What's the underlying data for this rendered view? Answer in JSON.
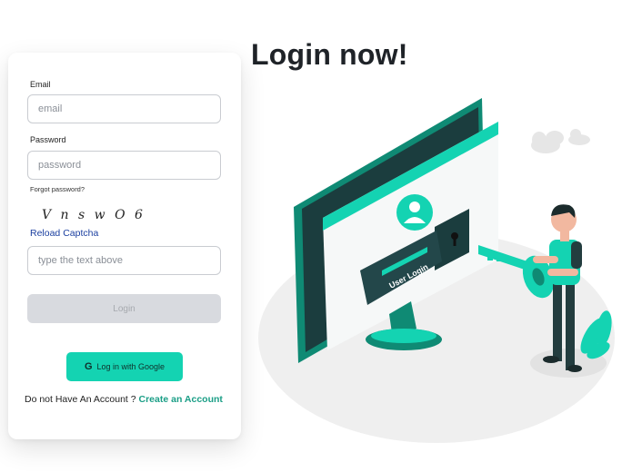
{
  "heading": "Login now!",
  "form": {
    "email_label": "Email",
    "email_placeholder": "email",
    "password_label": "Password",
    "password_placeholder": "password",
    "forgot_password": "Forgot password?",
    "captcha_text": "V n s w O 6",
    "reload_captcha": "Reload Captcha",
    "captcha_placeholder": "type the text above",
    "login_button": "Login",
    "google_icon": "G",
    "google_button": "Log in with Google",
    "signup_prompt": "Do not Have An Account ?",
    "signup_link": "Create an Account"
  },
  "illustration": {
    "screen_button_text": "User Login"
  },
  "colors": {
    "accent": "#14d3b2",
    "accent_dark": "#0f8a74",
    "link": "#1b3fa0",
    "signup_link": "#1a9e86",
    "disabled_button": "#d8dadf"
  }
}
